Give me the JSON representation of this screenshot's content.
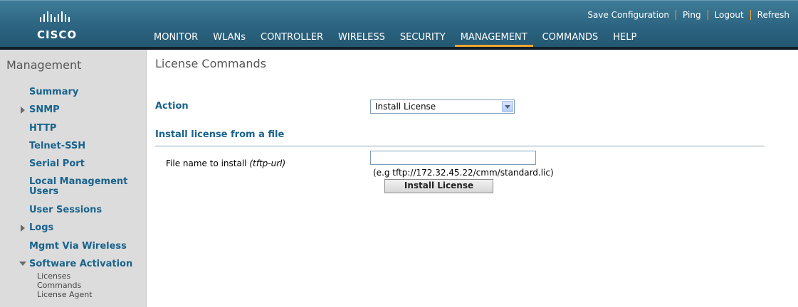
{
  "header": {
    "brand": "CISCO",
    "util_links": [
      "Save Configuration",
      "Ping",
      "Logout",
      "Refresh"
    ],
    "nav": [
      "MONITOR",
      "WLANs",
      "CONTROLLER",
      "WIRELESS",
      "SECURITY",
      "MANAGEMENT",
      "COMMANDS",
      "HELP"
    ],
    "active_nav": "MANAGEMENT",
    "accent_color": "#f2a431"
  },
  "sidebar": {
    "title": "Management",
    "items": [
      {
        "label": "Summary"
      },
      {
        "label": "SNMP",
        "expander": "collapsed"
      },
      {
        "label": "HTTP"
      },
      {
        "label": "Telnet-SSH"
      },
      {
        "label": "Serial Port"
      },
      {
        "label": "Local Management Users"
      },
      {
        "label": "User Sessions"
      },
      {
        "label": "Logs",
        "expander": "collapsed"
      },
      {
        "label": "Mgmt Via Wireless"
      },
      {
        "label": "Software Activation",
        "expander": "expanded"
      }
    ],
    "subitems": [
      "Licenses",
      "Commands",
      "License Agent"
    ]
  },
  "main": {
    "title": "License Commands",
    "action_label": "Action",
    "action_value": "Install License",
    "section_title": "Install license from a file",
    "file_label": "File name to install ",
    "file_label_hint": "(tftp-url)",
    "file_value": "",
    "file_example": "(e.g tftp://172.32.45.22/cmm/standard.lic)",
    "install_button": "Install License"
  }
}
